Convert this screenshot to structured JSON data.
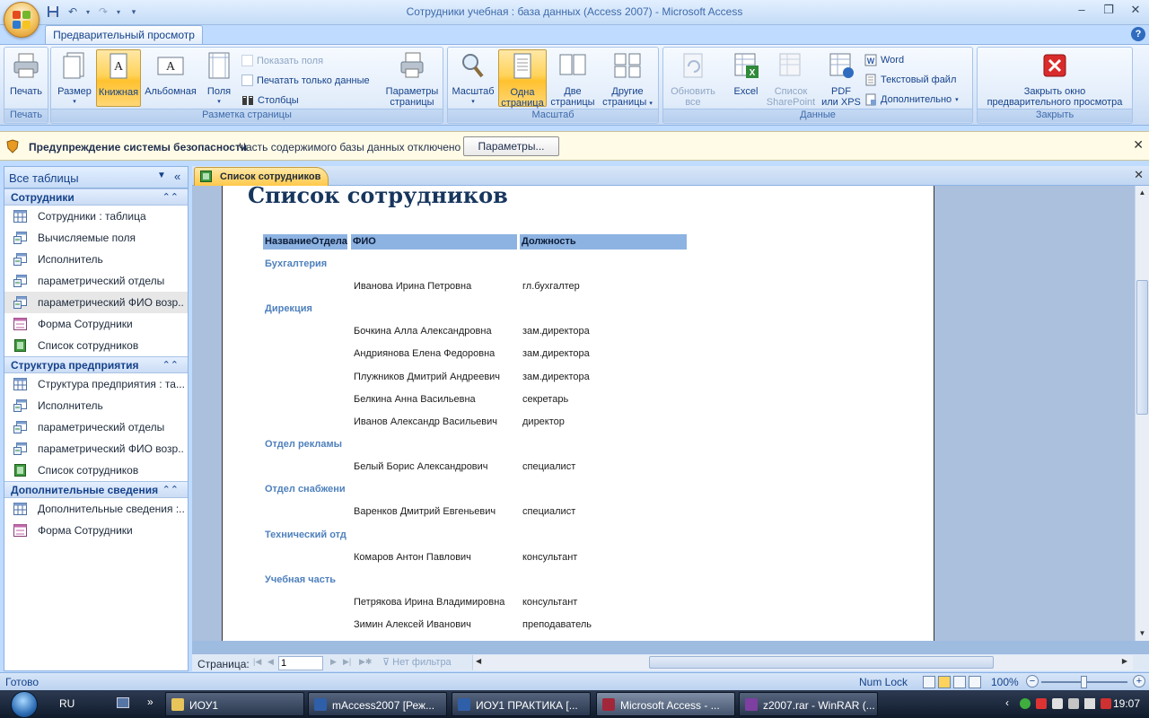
{
  "window": {
    "title": "Сотрудники учебная : база данных (Access 2007)  -  Microsoft Access"
  },
  "ribbon": {
    "tab": "Предварительный просмотр",
    "groups": {
      "print": {
        "label": "Печать",
        "print_btn": "Печать"
      },
      "page_layout": {
        "label": "Разметка страницы",
        "size_btn": "Размер",
        "portrait_btn": "Книжная",
        "landscape_btn": "Альбомная",
        "margins_btn": "Поля",
        "show_margins": "Показать поля",
        "print_data_only": "Печатать только данные",
        "columns": "Столбцы",
        "page_setup_btn_l1": "Параметры",
        "page_setup_btn_l2": "страницы"
      },
      "zoom": {
        "label": "Масштаб",
        "zoom_btn": "Масштаб",
        "one_page_l1": "Одна",
        "one_page_l2": "страница",
        "two_pages_l1": "Две",
        "two_pages_l2": "страницы",
        "more_pages_l1": "Другие",
        "more_pages_l2": "страницы"
      },
      "data": {
        "label": "Данные",
        "refresh_l1": "Обновить",
        "refresh_l2": "все",
        "excel": "Excel",
        "sharepoint_l1": "Список",
        "sharepoint_l2": "SharePoint",
        "pdf_l1": "PDF",
        "pdf_l2": "или XPS",
        "word": "Word",
        "text_file": "Текстовый файл",
        "more": "Дополнительно"
      },
      "close": {
        "label": "Закрыть",
        "close_l1": "Закрыть окно",
        "close_l2": "предварительного просмотра"
      }
    }
  },
  "security": {
    "title": "Предупреждение системы безопасности",
    "message": "Часть содержимого базы данных отключено",
    "button": "Параметры..."
  },
  "nav": {
    "title": "Все таблицы",
    "groups": [
      {
        "label": "Сотрудники",
        "items": [
          {
            "label": "Сотрудники : таблица",
            "icon": "table-icon"
          },
          {
            "label": "Вычисляемые поля",
            "icon": "query-icon"
          },
          {
            "label": "Исполнитель",
            "icon": "query-icon"
          },
          {
            "label": "параметрический отделы",
            "icon": "query-icon"
          },
          {
            "label": "параметрический ФИО возр...",
            "icon": "query-icon"
          },
          {
            "label": "Форма Сотрудники",
            "icon": "form-icon"
          },
          {
            "label": "Список сотрудников",
            "icon": "report-icon"
          }
        ]
      },
      {
        "label": "Структура предприятия",
        "items": [
          {
            "label": "Структура предприятия : та...",
            "icon": "table-icon"
          },
          {
            "label": "Исполнитель",
            "icon": "query-icon"
          },
          {
            "label": "параметрический отделы",
            "icon": "query-icon"
          },
          {
            "label": "параметрический ФИО возр...",
            "icon": "query-icon"
          },
          {
            "label": "Список сотрудников",
            "icon": "report-icon"
          }
        ]
      },
      {
        "label": "Дополнительные сведения",
        "items": [
          {
            "label": "Дополнительные сведения :...",
            "icon": "table-icon"
          },
          {
            "label": "Форма Сотрудники",
            "icon": "form-icon"
          }
        ]
      }
    ]
  },
  "document": {
    "tab": "Список сотрудников",
    "report": {
      "title": "Список сотрудников",
      "headers": [
        "НазваниеОтдела",
        "ФИО",
        "Должность"
      ],
      "departments": [
        {
          "name": "Бухгалтерия",
          "rows": [
            [
              "Иванова Ирина Петровна",
              "гл.бухгалтер"
            ]
          ]
        },
        {
          "name": "Дирекция",
          "rows": [
            [
              "Бочкина Алла Александровна",
              "зам.директора"
            ],
            [
              "Андриянова Елена Федоровна",
              "зам.директора"
            ],
            [
              "Плужников Дмитрий Андреевич",
              "зам.директора"
            ],
            [
              "Белкина Анна Васильевна",
              "секретарь"
            ],
            [
              "Иванов Александр Васильевич",
              "директор"
            ]
          ]
        },
        {
          "name": "Отдел рекламы",
          "rows": [
            [
              "Белый Борис Александрович",
              "специалист"
            ]
          ]
        },
        {
          "name": "Отдел снабжени",
          "rows": [
            [
              "Варенков Дмитрий Евгеньевич",
              "специалист"
            ]
          ]
        },
        {
          "name": "Технический отд",
          "rows": [
            [
              "Комаров Антон Павлович",
              "консультант"
            ]
          ]
        },
        {
          "name": "Учебная часть",
          "rows": [
            [
              "Петрякова Ирина Владимировна",
              "консультант"
            ],
            [
              "Зимин Алексей Иванович",
              "преподаватель"
            ]
          ]
        }
      ]
    },
    "pager": {
      "label": "Страница:",
      "page": "1",
      "filter": "Нет фильтра"
    }
  },
  "status": {
    "text": "Готово",
    "numlock": "Num Lock",
    "zoom": "100%"
  },
  "taskbar": {
    "lang": "RU",
    "items": [
      {
        "label": "ИОУ1",
        "icon": "folder-icon"
      },
      {
        "label": "mAccess2007 [Реж...",
        "icon": "word-doc-icon"
      },
      {
        "label": "ИОУ1 ПРАКТИКА [...",
        "icon": "word-doc-icon"
      },
      {
        "label": "Microsoft Access - ...",
        "icon": "access-icon"
      },
      {
        "label": "z2007.rar - WinRAR (...",
        "icon": "winrar-icon"
      }
    ],
    "clock": "19:07"
  },
  "colors": {
    "accent": "#15428b",
    "ribbon_active": "#ffc84a",
    "report_header": "#8db3e2",
    "department_text": "#4f81bd"
  }
}
